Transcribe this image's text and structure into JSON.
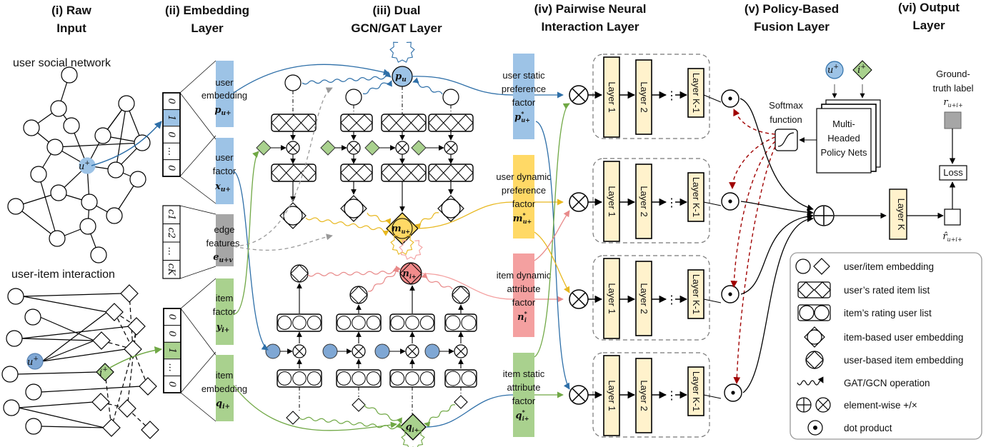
{
  "colors": {
    "user_blue": "#9dc3e6",
    "user_blue_dark": "#2e6fa8",
    "item_green": "#a9d18e",
    "item_green_dark": "#70a845",
    "dynamic_yellow": "#ffd966",
    "dynamic_yellow_dark": "#e8b820",
    "item_dyn_red": "#f4a0a0",
    "item_dyn_red_dark": "#e06666",
    "edge_gray": "#a6a6a6",
    "layer_fill": "#fff2cc",
    "policy_red": "#a00000",
    "line": "#000000"
  },
  "headers": [
    {
      "line1": "(i) Raw",
      "line2": "Input"
    },
    {
      "line1": "(ii) Embedding",
      "line2": "Layer"
    },
    {
      "line1": "(iii) Dual",
      "line2": "GCN/GAT Layer"
    },
    {
      "line1": "(iv) Pairwise Neural",
      "line2": "Interaction Layer"
    },
    {
      "line1": "(v) Policy-Based",
      "line2": "Fusion Layer"
    },
    {
      "line1": "(vi) Output",
      "line2": "Layer"
    }
  ],
  "raw_input": {
    "social_label": "user social network",
    "interaction_label": "user-item interaction",
    "user_node": "u",
    "user_sup": "+",
    "item_node": "i",
    "item_sup": "+"
  },
  "embedding": {
    "user_onehot": [
      "0",
      "1",
      "0",
      "...",
      "0"
    ],
    "item_onehot": [
      "0",
      "0",
      "1",
      "...",
      "0"
    ],
    "edge_vector": [
      "c1",
      "c2",
      "...",
      "cK"
    ],
    "user_embedding": {
      "line1": "user",
      "line2": "embedding",
      "symbol": "p",
      "sub": "u+"
    },
    "user_factor": {
      "line1": "user",
      "line2": "factor",
      "symbol": "x",
      "sub": "u+"
    },
    "edge_features": {
      "line1": "edge",
      "line2": "features",
      "symbol": "e",
      "sub": "u+v"
    },
    "item_factor": {
      "line1": "item",
      "line2": "factor",
      "symbol": "y",
      "sub": "i+"
    },
    "item_embedding": {
      "line1": "item",
      "line2": "embedding",
      "symbol": "q",
      "sub": "i+"
    }
  },
  "gcn": {
    "p_node": {
      "symbol": "p",
      "sub": "u"
    },
    "m_node": {
      "symbol": "m",
      "sub": "u+"
    },
    "n_node": {
      "symbol": "n",
      "sub": "i+"
    },
    "q_node": {
      "symbol": "q",
      "sub": "i+"
    }
  },
  "interaction": {
    "factors": [
      {
        "line1": "user static",
        "line2": "preference",
        "line3": "factor",
        "symbol": "p",
        "sub": "u+",
        "sup": "*"
      },
      {
        "line1": "user dynamic",
        "line2": "preference",
        "line3": "factor",
        "symbol": "m",
        "sub": "u+",
        "sup": "*"
      },
      {
        "line1": "item dynamic",
        "line2": "attribute",
        "line3": "factor",
        "symbol": "n",
        "sub": "i",
        "sup": "*"
      },
      {
        "line1": "item static",
        "line2": "attribute",
        "line3": "factor",
        "symbol": "q",
        "sub": "i+",
        "sup": "*"
      }
    ],
    "layers": [
      "Layer 1",
      "Layer 2",
      "Layer K-1"
    ],
    "ellipsis": "⋮"
  },
  "fusion": {
    "softmax_line1": "Softmax",
    "softmax_line2": "function",
    "policy_line1": "Multi-",
    "policy_line2": "Headed",
    "policy_line3": "Policy Nets",
    "user_node": "u",
    "item_node": "i",
    "sup": "+"
  },
  "output": {
    "gt_line1": "Ground-",
    "gt_line2": "truth label",
    "gt_symbol": "r",
    "gt_sub": "u+i+",
    "loss": "Loss",
    "layer_k": "Layer K",
    "pred_symbol": "r̂",
    "pred_sub": "u+i+"
  },
  "legend": [
    {
      "icon": "circle-diamond-icon",
      "label": "user/item embedding"
    },
    {
      "icon": "rated-item-list-icon",
      "label": "user’s rated item list"
    },
    {
      "icon": "rating-user-list-icon",
      "label": "item’s rating user list"
    },
    {
      "icon": "item-based-user-embedding-icon",
      "label": "item-based user embedding"
    },
    {
      "icon": "user-based-item-embedding-icon",
      "label": "user-based item embedding"
    },
    {
      "icon": "wavy-arrow-icon",
      "label": "GAT/GCN operation"
    },
    {
      "icon": "plus-times-icon",
      "label": "element-wise +/×"
    },
    {
      "icon": "dot-product-icon",
      "label": "dot product"
    }
  ]
}
